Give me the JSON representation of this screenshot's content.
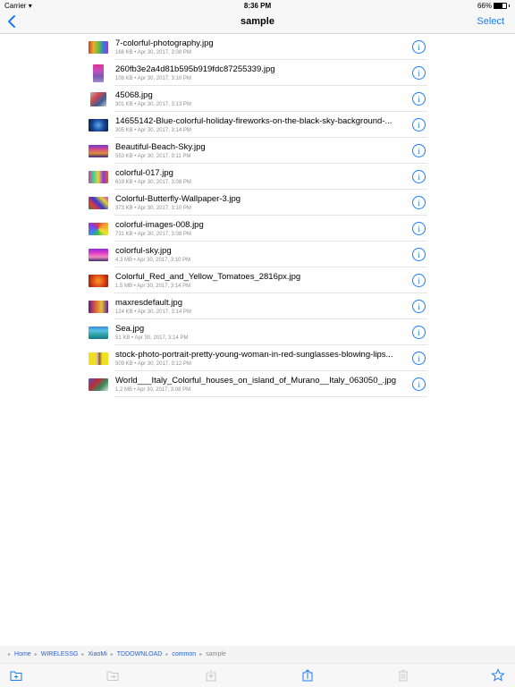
{
  "status_bar": {
    "carrier": "Carrier",
    "time": "8:36 PM",
    "battery": "66%",
    "battery_level": 0.66
  },
  "nav": {
    "title": "sample",
    "select_label": "Select",
    "back_icon": "chevron-left-icon"
  },
  "colors": {
    "accent": "#1a7cf5",
    "meta_text": "#8e8e93",
    "disabled": "#c8c8c8"
  },
  "files": [
    {
      "name": "7-colorful-photography.jpg",
      "meta": "166 KB • Apr 30, 2017, 3:08 PM",
      "thumb": "linear-gradient(90deg,#d23a2a,#e5b02c,#6fbf3a,#2f7fd8,#9a3ad8)",
      "shape": "wide"
    },
    {
      "name": "260fb3e2a4d81b595b919fdc87255339.jpg",
      "meta": "108 KB • Apr 30, 2017, 3:10 PM",
      "thumb": "linear-gradient(180deg,#e0308f,#c84cc0,#7a5ab0,#a08ad0)",
      "shape": "tall"
    },
    {
      "name": "45068.jpg",
      "meta": "301 KB • Apr 30, 2017, 3:13 PM",
      "thumb": "linear-gradient(135deg,#b8b8c0,#d44a4a,#3a5a9a,#c8c8c8)",
      "shape": "sq"
    },
    {
      "name": "14655142-Blue-colorful-holiday-fireworks-on-the-black-sky-background-...",
      "meta": "305 KB • Apr 30, 2017, 3:14 PM",
      "thumb": "radial-gradient(circle,#5aa8f0,#1a4a9a,#0a1a3a)",
      "shape": "wide"
    },
    {
      "name": "Beautiful-Beach-Sky.jpg",
      "meta": "553 KB • Apr 30, 2017, 3:11 PM",
      "thumb": "linear-gradient(180deg,#6a3ad0,#d04a8a,#e08a3a,#3a2a7a)",
      "shape": "wide"
    },
    {
      "name": "colorful-017.jpg",
      "meta": "619 KB • Apr 30, 2017, 3:08 PM",
      "thumb": "linear-gradient(90deg,#e03a8a,#3ad0a0,#f0d030,#8a3ae0,#e05a2a)",
      "shape": "wide"
    },
    {
      "name": "Colorful-Butterfly-Wallpaper-3.jpg",
      "meta": "373 KB • Apr 30, 2017, 3:10 PM",
      "thumb": "linear-gradient(45deg,#2a8a3a,#e03a3a,#3a3ad0,#e0d03a,#d03ac0)",
      "shape": "wide"
    },
    {
      "name": "colorful-images-008.jpg",
      "meta": "731 KB • Apr 30, 2017, 3:08 PM",
      "thumb": "conic-gradient(#e03a3a,#f0a030,#f0e030,#3ac03a,#3a8ae0,#8a3ae0,#e03a3a)",
      "shape": "wide"
    },
    {
      "name": "colorful-sky.jpg",
      "meta": "4.3 MB • Apr 30, 2017, 3:10 PM",
      "thumb": "linear-gradient(180deg,#8a2ae0,#e03ac0,#f08ac0,#3a2a6a)",
      "shape": "wide"
    },
    {
      "name": "Colorful_Red_and_Yellow_Tomatoes_2816px.jpg",
      "meta": "1.5 MB • Apr 30, 2017, 3:14 PM",
      "thumb": "radial-gradient(circle,#f0a020,#e04a1a,#8a1a0a)",
      "shape": "wide"
    },
    {
      "name": "maxresdefault.jpg",
      "meta": "124 KB • Apr 30, 2017, 3:14 PM",
      "thumb": "linear-gradient(90deg,#5a1a9a,#e05a3a,#e0c03a,#5a1a9a)",
      "shape": "wide"
    },
    {
      "name": "Sea.jpg",
      "meta": "51 KB • Apr 30, 2017, 3:14 PM",
      "thumb": "linear-gradient(180deg,#3a8ae0,#5ac0e0,#2aa0a0,#1a7a8a)",
      "shape": "wide"
    },
    {
      "name": "stock-photo-portrait-pretty-young-woman-in-red-sunglasses-blowing-lips...",
      "meta": "509 KB • Apr 30, 2017, 3:12 PM",
      "thumb": "linear-gradient(90deg,#f0e020 30%,#e0c0a0 45%,#8a5a3a 55%,#f0e020 70%)",
      "shape": "wide"
    },
    {
      "name": "World___Italy_Colorful_houses_on_island_of_Murano__Italy_063050_.jpg",
      "meta": "1.2 MB • Apr 30, 2017, 3:08 PM",
      "thumb": "linear-gradient(135deg,#3a5ad0,#c02a3a,#3a8a5a,#e0e0e0)",
      "shape": "wide"
    }
  ],
  "breadcrumb": [
    {
      "label": "Home",
      "current": false
    },
    {
      "label": "WIRELESSG",
      "current": false
    },
    {
      "label": "XiaoMi",
      "current": false
    },
    {
      "label": "TDDOWNLOAD",
      "current": false
    },
    {
      "label": "common",
      "current": false
    },
    {
      "label": "sample",
      "current": true
    }
  ],
  "toolbar": [
    {
      "name": "new-folder",
      "icon": "folder-plus-icon",
      "enabled": true
    },
    {
      "name": "move",
      "icon": "folder-move-icon",
      "enabled": false
    },
    {
      "name": "download",
      "icon": "download-icon",
      "enabled": false
    },
    {
      "name": "share",
      "icon": "share-icon",
      "enabled": true
    },
    {
      "name": "delete",
      "icon": "trash-icon",
      "enabled": false
    },
    {
      "name": "favorite",
      "icon": "star-icon",
      "enabled": true
    }
  ]
}
